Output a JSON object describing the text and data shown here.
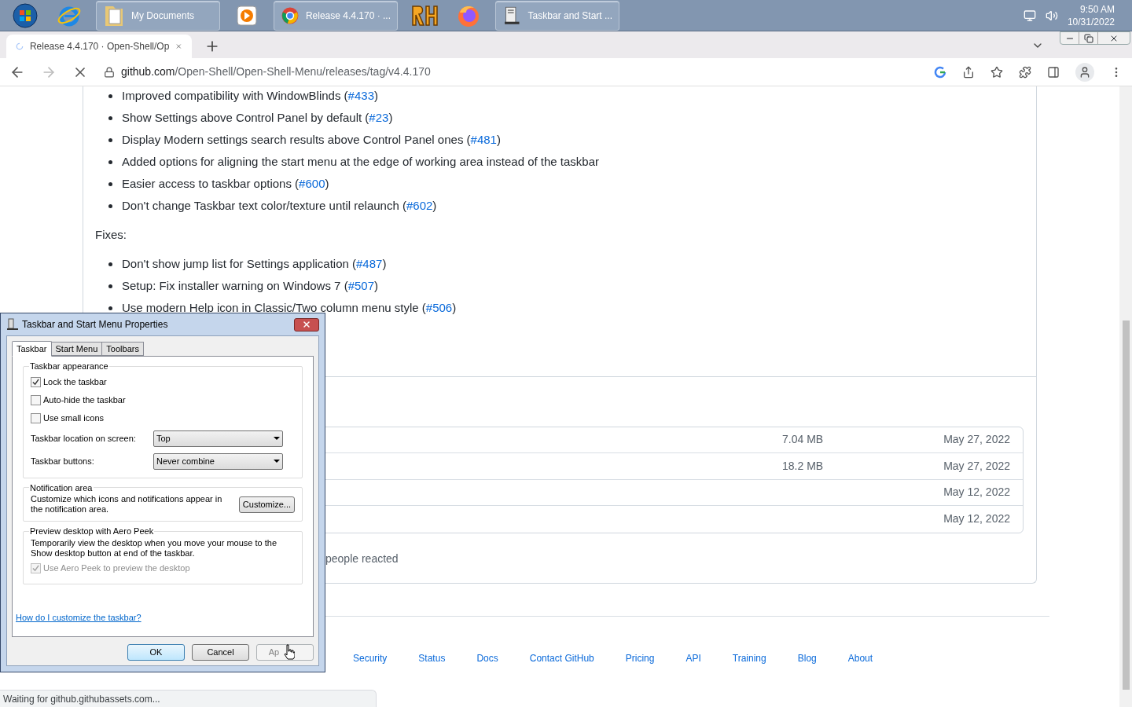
{
  "taskbar": {
    "items": [
      {
        "kind": "start"
      },
      {
        "kind": "pinned"
      },
      {
        "kind": "window",
        "label": "My Documents"
      },
      {
        "kind": "pinned"
      },
      {
        "kind": "window",
        "label": "Release 4.4.170 · ..."
      },
      {
        "kind": "pinned"
      },
      {
        "kind": "pinned"
      },
      {
        "kind": "window",
        "label": "Taskbar and Start ..."
      }
    ],
    "time": "9:50 AM",
    "date": "10/31/2022"
  },
  "browser": {
    "tab_title": "Release 4.4.170 · Open-Shell/Op",
    "url_host": "github.com",
    "url_path": "/Open-Shell/Open-Shell-Menu/releases/tag/v4.4.170",
    "status_text": "Waiting for github.githubassets.com..."
  },
  "notes": [
    {
      "before": "Improved compatibility with WindowBlinds (",
      "link": "#433",
      "after": ")"
    },
    {
      "before": "Show Settings above Control Panel by default (",
      "link": "#23",
      "after": ")"
    },
    {
      "before": "Display Modern settings search results above Control Panel ones (",
      "link": "#481",
      "after": ")"
    },
    {
      "before": "Added options for aligning the start menu at the edge of working area instead of the taskbar"
    },
    {
      "before": "Easier access to taskbar options (",
      "link": "#600",
      "after": ")"
    },
    {
      "before": "Don't change Taskbar text color/texture until relaunch (",
      "link": "#602",
      "after": ")"
    }
  ],
  "fixes_heading": "Fixes:",
  "fixes": [
    {
      "before": "Don't show jump list for Settings application (",
      "link": "#487",
      "after": ")"
    },
    {
      "before": "Setup: Fix installer warning on Windows 7 (",
      "link": "#507",
      "after": ")"
    },
    {
      "before": "Use modern Help icon in Classic/Two column menu style (",
      "link": "#506",
      "after": ")"
    }
  ],
  "assets": [
    {
      "size": "7.04 MB",
      "date": "May 27, 2022"
    },
    {
      "size": "18.2 MB",
      "date": "May 27, 2022"
    },
    {
      "date": "May 12, 2022"
    },
    {
      "date": "May 12, 2022"
    }
  ],
  "reactions": "people reacted",
  "footer_links": [
    "Security",
    "Status",
    "Docs",
    "Contact GitHub",
    "Pricing",
    "API",
    "Training",
    "Blog",
    "About"
  ],
  "dialog": {
    "title": "Taskbar and Start Menu Properties",
    "tabs": [
      {
        "label": "Taskbar",
        "selected": true
      },
      {
        "label": "Start Menu",
        "selected": false
      },
      {
        "label": "Toolbars",
        "selected": false
      }
    ],
    "appearance": {
      "title": "Taskbar appearance",
      "checkboxes": [
        {
          "label": "Lock the taskbar",
          "checked": true
        },
        {
          "label": "Auto-hide the taskbar",
          "checked": false
        },
        {
          "label": "Use small icons",
          "checked": false
        }
      ],
      "selects": [
        {
          "label": "Taskbar location on screen:",
          "value": "Top"
        },
        {
          "label": "Taskbar buttons:",
          "value": "Never combine"
        }
      ]
    },
    "notification": {
      "title": "Notification area",
      "text": "Customize which icons and notifications appear in the notification area.",
      "button": "Customize..."
    },
    "aero": {
      "title": "Preview desktop with Aero Peek",
      "text": "Temporarily view the desktop when you move your mouse to the Show desktop button at end of the taskbar.",
      "checkbox": {
        "label": "Use Aero Peek to preview the desktop",
        "checked": true,
        "disabled": true
      }
    },
    "help_link": "How do I customize the taskbar?",
    "buttons": [
      {
        "label": "OK",
        "default": true,
        "disabled": false
      },
      {
        "label": "Cancel",
        "default": false,
        "disabled": false
      },
      {
        "label": "Ap",
        "default": false,
        "disabled": true
      }
    ]
  }
}
